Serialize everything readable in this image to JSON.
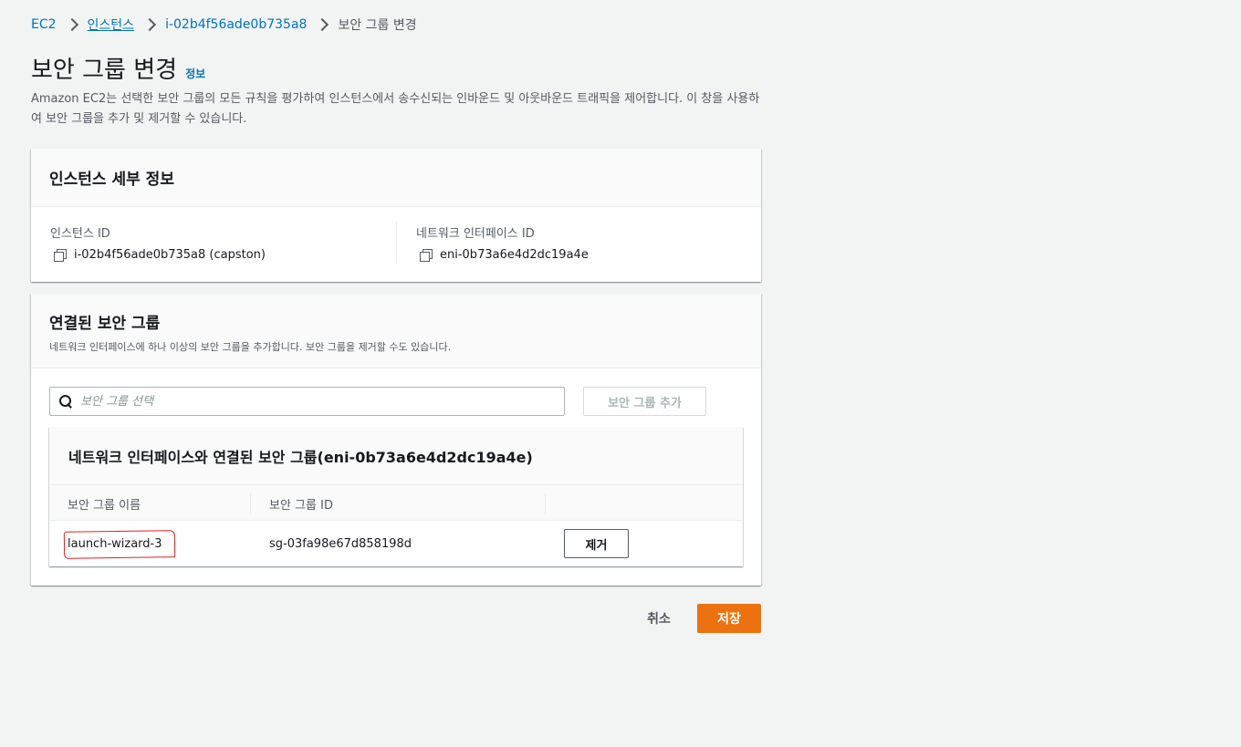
{
  "breadcrumb": {
    "items": [
      "EC2",
      "인스턴스",
      "i-02b4f56ade0b735a8",
      "보안 그룹 변경"
    ]
  },
  "header": {
    "title": "보안 그룹 변경",
    "info_link": "정보",
    "description": "Amazon EC2는 선택한 보안 그룹의 모든 규칙을 평가하여 인스턴스에서 송수신되는 인바운드 및 아웃바운드 트래픽을 제어합니다. 이 창을 사용하여 보안 그룹을 추가 및 제거할 수 있습니다."
  },
  "instance_details": {
    "title": "인스턴스 세부 정보",
    "instance_id_label": "인스턴스 ID",
    "instance_id_value": "i-02b4f56ade0b735a8 (capston)",
    "eni_label": "네트워크 인터페이스 ID",
    "eni_value": "eni-0b73a6e4d2dc19a4e"
  },
  "associated_sg": {
    "title": "연결된 보안 그룹",
    "subtitle": "네트워크 인터페이스에 하나 이상의 보안 그룹을 추가합니다. 보안 그룹을 제거할 수도 있습니다.",
    "search_placeholder": "보안 그룹 선택",
    "add_button": "보안 그룹 추가",
    "table_title": "네트워크 인터페이스와 연결된 보안 그룹(eni-0b73a6e4d2dc19a4e)",
    "columns": [
      "보안 그룹 이름",
      "보안 그룹 ID"
    ],
    "rows": [
      {
        "name": "launch-wizard-3",
        "id": "sg-03fa98e67d858198d",
        "action": "제거"
      }
    ]
  },
  "footer": {
    "cancel": "취소",
    "save": "저장"
  },
  "colors": {
    "link": "#0073bb",
    "primary": "#ec7211",
    "background": "#f2f3f3",
    "annotation": "#e02020"
  }
}
